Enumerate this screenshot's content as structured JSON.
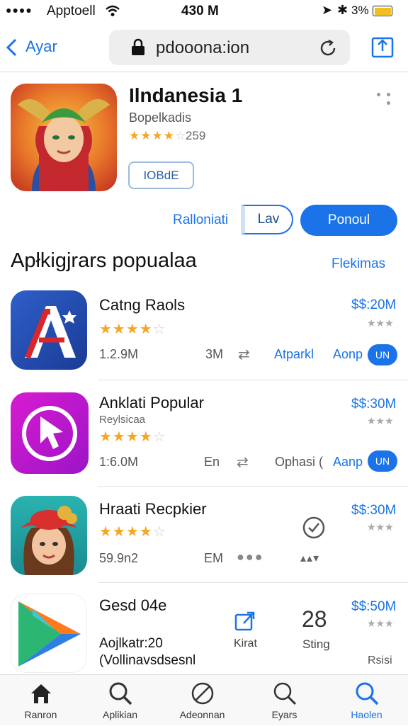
{
  "status": {
    "carrier": "Apptoell",
    "time": "430 M",
    "battery": "3%"
  },
  "nav": {
    "back_label": "Ayar",
    "url": "pdooona:ion"
  },
  "hero": {
    "title": "Ilndanesia 1",
    "subtitle": "Bopelkadis",
    "rating_count": "259",
    "download_label": "IOBdE",
    "toggle_left": "Ralloniati",
    "toggle_right": "Lav",
    "primary_button": "Ponoul"
  },
  "section": {
    "title": "Apłkigjrars popualaa",
    "link": "Flekimas"
  },
  "apps": [
    {
      "name": "Catng Raols",
      "price": "$$:20M",
      "size": "1.2.9M",
      "meta": "3M",
      "action": "Atparkl",
      "install": "Aonp",
      "pill": "UN"
    },
    {
      "name": "Anklati Popular",
      "sub": "Reylsicaa",
      "price": "$$:30M",
      "size": "1:6.0M",
      "meta": "En",
      "action": "Ophasi (",
      "install": "Aanp",
      "pill": "UN"
    },
    {
      "name": "Hraati Recpkier",
      "price": "$$:30M",
      "size": "59.9n2",
      "meta": "EM"
    },
    {
      "name": "Gesd 04e",
      "price": "$$:50M",
      "line1": "Aojlkatr:20",
      "line2": "(Vollinavsdsesnl",
      "action1": "Kirat",
      "stat": "28",
      "action2": "Sting",
      "extra": "Rsisi"
    }
  ],
  "tabs": [
    "Ranron",
    "Aplikian",
    "Adeonnan",
    "Eyars",
    "Haolen"
  ],
  "colors": {
    "accent": "#1a73e8",
    "star": "#f5a623"
  }
}
